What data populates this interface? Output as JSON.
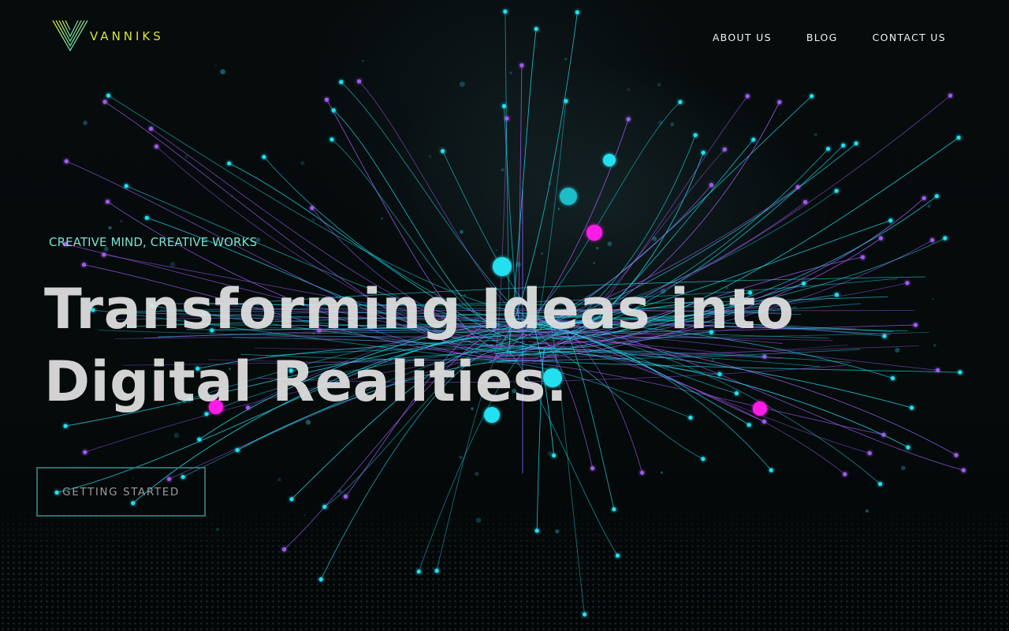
{
  "brand": {
    "name": "VANNIKS",
    "logo_icon": "v-stripes-logo-icon",
    "accent_color": "#d9e43c",
    "logo_gradient": [
      "#d9e43c",
      "#3fd2c7"
    ]
  },
  "nav": {
    "items": [
      {
        "label": "ABOUT US"
      },
      {
        "label": "BLOG"
      },
      {
        "label": "CONTACT US"
      }
    ]
  },
  "hero": {
    "tagline": "CREATIVE MIND, CREATIVE WORKS",
    "headline_line1": "Transforming Ideas into",
    "headline_line2": "Digital Realities.",
    "cta_label": "GETTING STARTED",
    "tagline_color": "#79e3cf",
    "cta_border_color": "#2f6f70"
  },
  "background": {
    "graphic": "particle-network-graphic",
    "colors": {
      "cyan": "#22e0f0",
      "violet": "#a05cf0",
      "magenta": "#ff1ce8"
    }
  }
}
